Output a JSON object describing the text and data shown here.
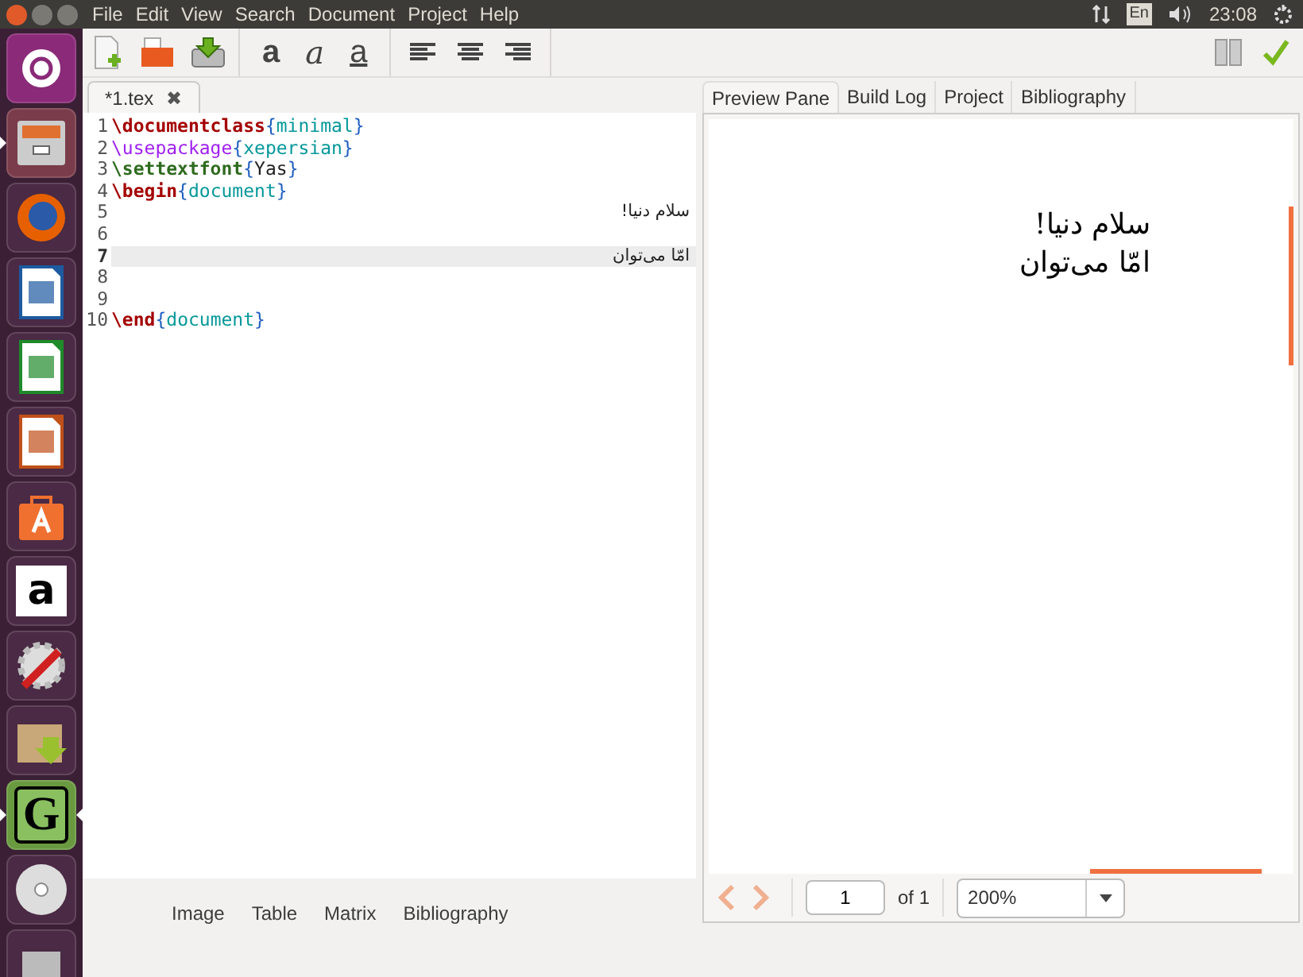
{
  "menu": [
    "File",
    "Edit",
    "View",
    "Search",
    "Document",
    "Project",
    "Help"
  ],
  "indicators": {
    "keyboard": "En",
    "clock": "23:08"
  },
  "launcher": [
    {
      "kind": "ubuntu",
      "running": false,
      "focused": false
    },
    {
      "kind": "files",
      "running": true,
      "focused": false
    },
    {
      "kind": "firefox",
      "running": false,
      "focused": false
    },
    {
      "kind": "writer",
      "running": false,
      "focused": false
    },
    {
      "kind": "calc",
      "running": false,
      "focused": false
    },
    {
      "kind": "impress",
      "running": false,
      "focused": false
    },
    {
      "kind": "software",
      "running": false,
      "focused": false
    },
    {
      "kind": "amazon",
      "glyph": "a",
      "running": false,
      "focused": false
    },
    {
      "kind": "settings",
      "running": false,
      "focused": false
    },
    {
      "kind": "archive",
      "running": false,
      "focused": false
    },
    {
      "kind": "gedit",
      "glyph": "G",
      "running": true,
      "focused": true
    },
    {
      "kind": "disc",
      "running": false,
      "focused": false
    },
    {
      "kind": "trash",
      "running": false,
      "focused": false
    }
  ],
  "toolbar": {
    "format_buttons": [
      {
        "kind": "bold",
        "glyph": "a"
      },
      {
        "kind": "italic",
        "glyph": "a"
      },
      {
        "kind": "underline",
        "glyph": "a"
      }
    ]
  },
  "editor": {
    "tab": {
      "label": "*1.tex",
      "close": "✖"
    },
    "lines": [
      {
        "number": "1",
        "current": false,
        "segments": [
          {
            "kind": "cmd",
            "text": "\\documentclass"
          },
          {
            "kind": "brace",
            "text": "{"
          },
          {
            "kind": "arg",
            "text": "minimal"
          },
          {
            "kind": "brace",
            "text": "}"
          }
        ]
      },
      {
        "number": "2",
        "current": false,
        "segments": [
          {
            "kind": "pkg",
            "text": "\\usepackage"
          },
          {
            "kind": "brace",
            "text": "{"
          },
          {
            "kind": "arg",
            "text": "xepersian"
          },
          {
            "kind": "brace",
            "text": "}"
          }
        ]
      },
      {
        "number": "3",
        "current": false,
        "segments": [
          {
            "kind": "font",
            "text": "\\settextfont"
          },
          {
            "kind": "brace",
            "text": "{"
          },
          {
            "kind": "plain",
            "text": "Yas"
          },
          {
            "kind": "brace",
            "text": "}"
          }
        ]
      },
      {
        "number": "4",
        "current": false,
        "segments": [
          {
            "kind": "cmd",
            "text": "\\begin"
          },
          {
            "kind": "brace",
            "text": "{"
          },
          {
            "kind": "arg",
            "text": "document"
          },
          {
            "kind": "brace",
            "text": "}"
          }
        ]
      },
      {
        "number": "5",
        "current": false,
        "segments": [
          {
            "kind": "rtl",
            "text": "سلام دنیا!"
          }
        ]
      },
      {
        "number": "6",
        "current": false
      },
      {
        "number": "7",
        "current": true,
        "segments": [
          {
            "kind": "rtl",
            "text": "امّا می‌توان"
          }
        ]
      },
      {
        "number": "8",
        "current": false
      },
      {
        "number": "9",
        "current": false
      },
      {
        "number": "10",
        "current": false,
        "segments": [
          {
            "kind": "cmd",
            "text": "\\end"
          },
          {
            "kind": "brace",
            "text": "{"
          },
          {
            "kind": "arg",
            "text": "document"
          },
          {
            "kind": "brace",
            "text": "}"
          }
        ]
      }
    ]
  },
  "bottom_tabs": [
    "Image",
    "Table",
    "Matrix",
    "Bibliography"
  ],
  "right_tabs": [
    {
      "label": "Preview Pane",
      "selected": true
    },
    {
      "label": "Build Log",
      "selected": false
    },
    {
      "label": "Project",
      "selected": false
    },
    {
      "label": "Bibliography",
      "selected": false
    }
  ],
  "preview": {
    "lines": [
      "سلام دنیا!",
      "امّا می‌توان"
    ]
  },
  "pager": {
    "page": "1",
    "of": "of 1",
    "zoom": "200%"
  }
}
